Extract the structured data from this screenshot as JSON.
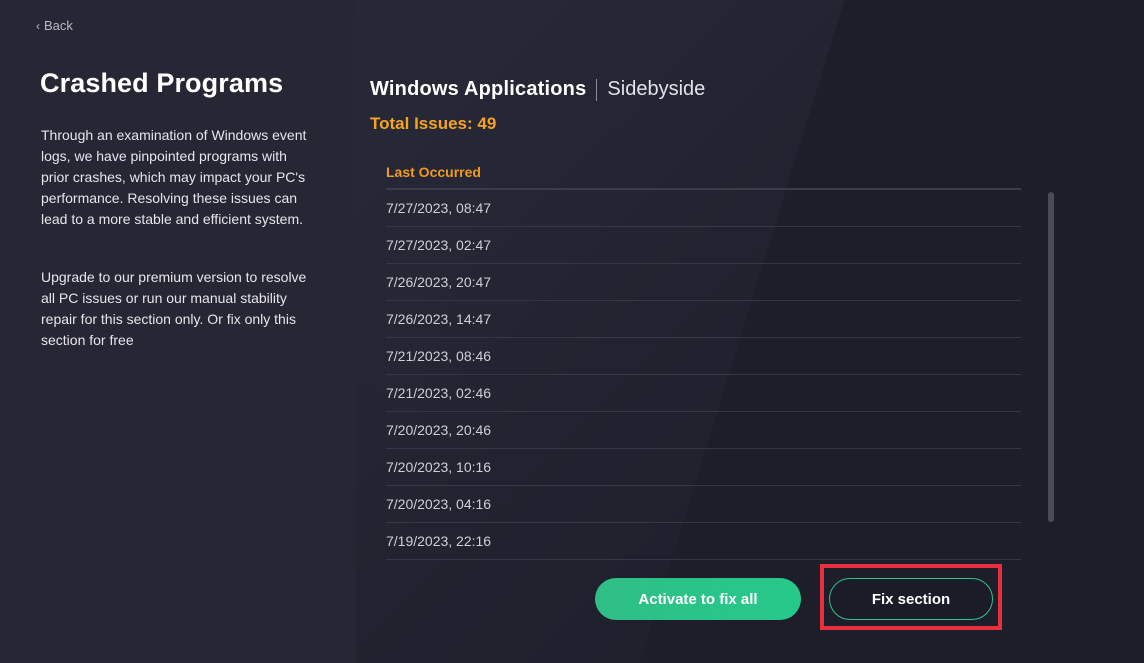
{
  "sidebar": {
    "back_label": "Back",
    "title": "Crashed Programs",
    "description_1": "Through an examination of Windows event logs, we have pinpointed programs with prior crashes, which may impact your PC's performance. Resolving these issues can lead to a more stable and efficient system.",
    "description_2": "Upgrade to our premium version to resolve all PC issues or run our manual stability repair for this section only. Or fix only this section for free"
  },
  "main": {
    "app_name": "Windows Applications",
    "app_sub": "Sidebyside",
    "total_issues": "Total Issues: 49",
    "table": {
      "column_header": "Last Occurred",
      "rows": [
        "7/27/2023, 08:47",
        "7/27/2023, 02:47",
        "7/26/2023, 20:47",
        "7/26/2023, 14:47",
        "7/21/2023, 08:46",
        "7/21/2023, 02:46",
        "7/20/2023, 20:46",
        "7/20/2023, 10:16",
        "7/20/2023, 04:16",
        "7/19/2023, 22:16"
      ]
    },
    "buttons": {
      "activate_label": "Activate to fix all",
      "fix_section_label": "Fix section"
    }
  },
  "icons": {
    "back": "chevron-left-icon"
  },
  "colors": {
    "accent_orange": "#f5a323",
    "accent_green": "#2bc58a",
    "highlight_red": "#e8303c"
  }
}
